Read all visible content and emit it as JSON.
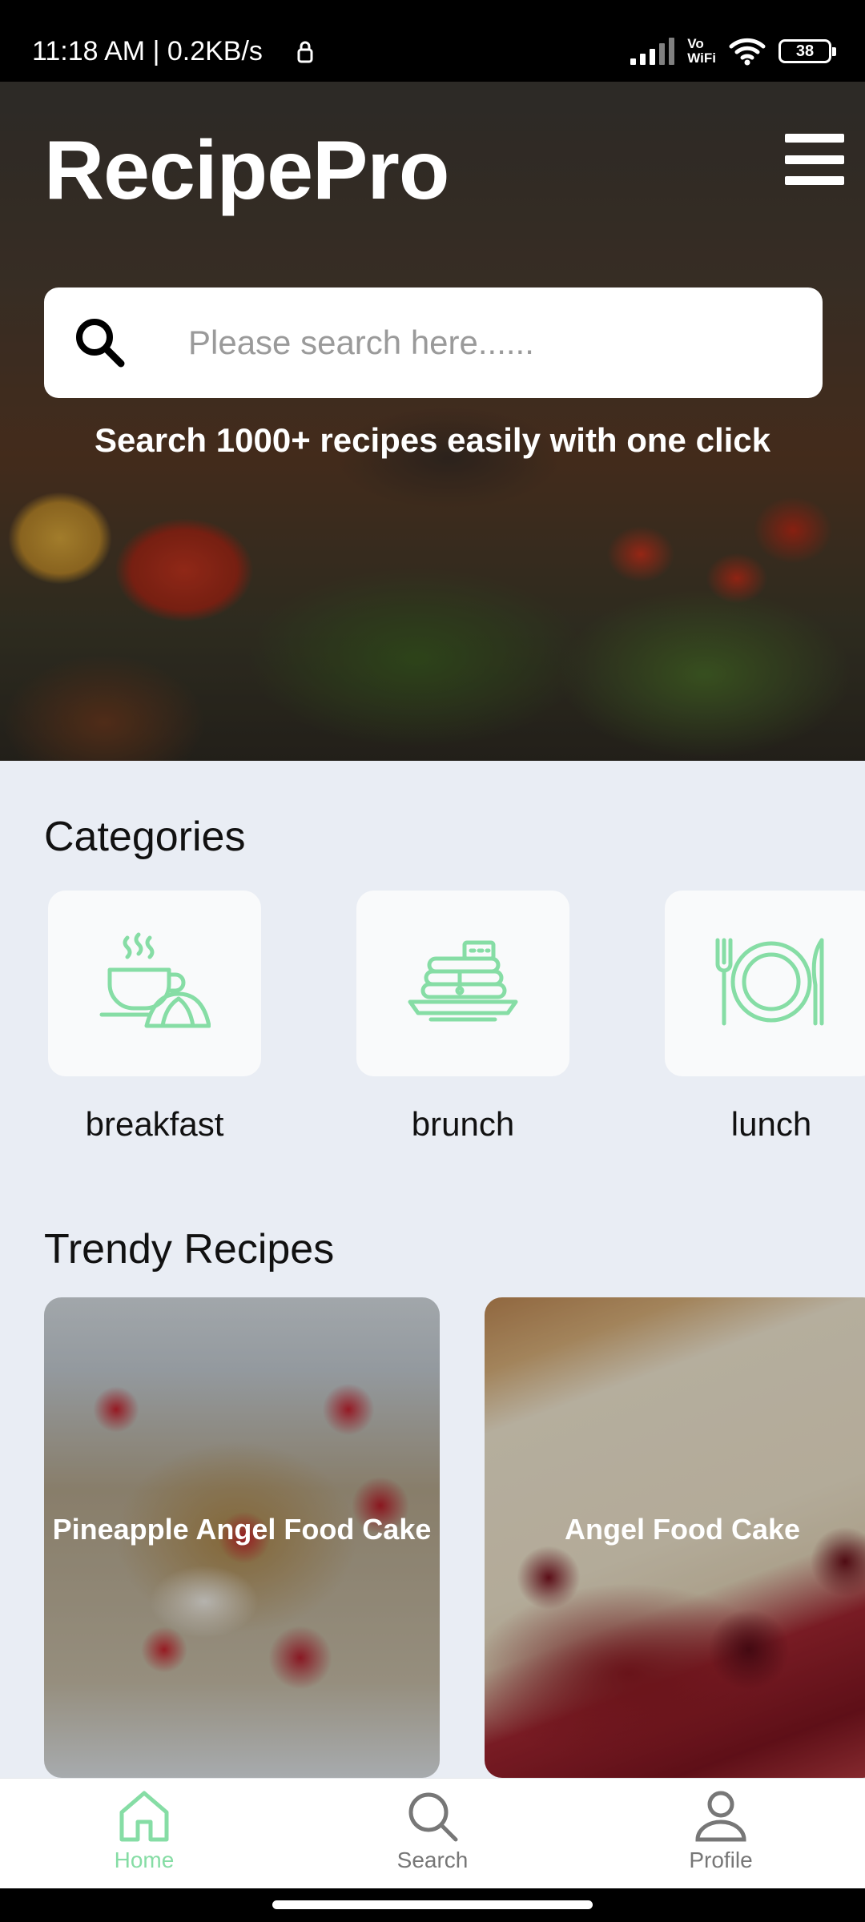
{
  "status_bar": {
    "time": "11:18 AM | 0.2KB/s",
    "vowifi_top": "Vo",
    "vowifi_bottom": "WiFi",
    "battery": "38"
  },
  "header": {
    "app_name": "RecipePro",
    "search_placeholder": "Please search here......",
    "tagline": "Search 1000+ recipes easily with one click"
  },
  "categories": {
    "title": "Categories",
    "items": [
      {
        "label": "breakfast",
        "icon": "coffee-croissant-icon"
      },
      {
        "label": "brunch",
        "icon": "pancake-stack-icon"
      },
      {
        "label": "lunch",
        "icon": "plate-fork-knife-icon"
      }
    ]
  },
  "trendy": {
    "title": "Trendy Recipes",
    "items": [
      {
        "name": "Pineapple Angel Food Cake"
      },
      {
        "name": "Angel Food Cake"
      }
    ]
  },
  "bottom_nav": {
    "items": [
      {
        "label": "Home",
        "icon": "home-icon",
        "active": true
      },
      {
        "label": "Search",
        "icon": "search-icon",
        "active": false
      },
      {
        "label": "Profile",
        "icon": "profile-icon",
        "active": false
      }
    ]
  },
  "colors": {
    "accent": "#86DDA5",
    "background": "#E9EDF4",
    "card": "#F9FAFB",
    "inactive": "#777777"
  }
}
